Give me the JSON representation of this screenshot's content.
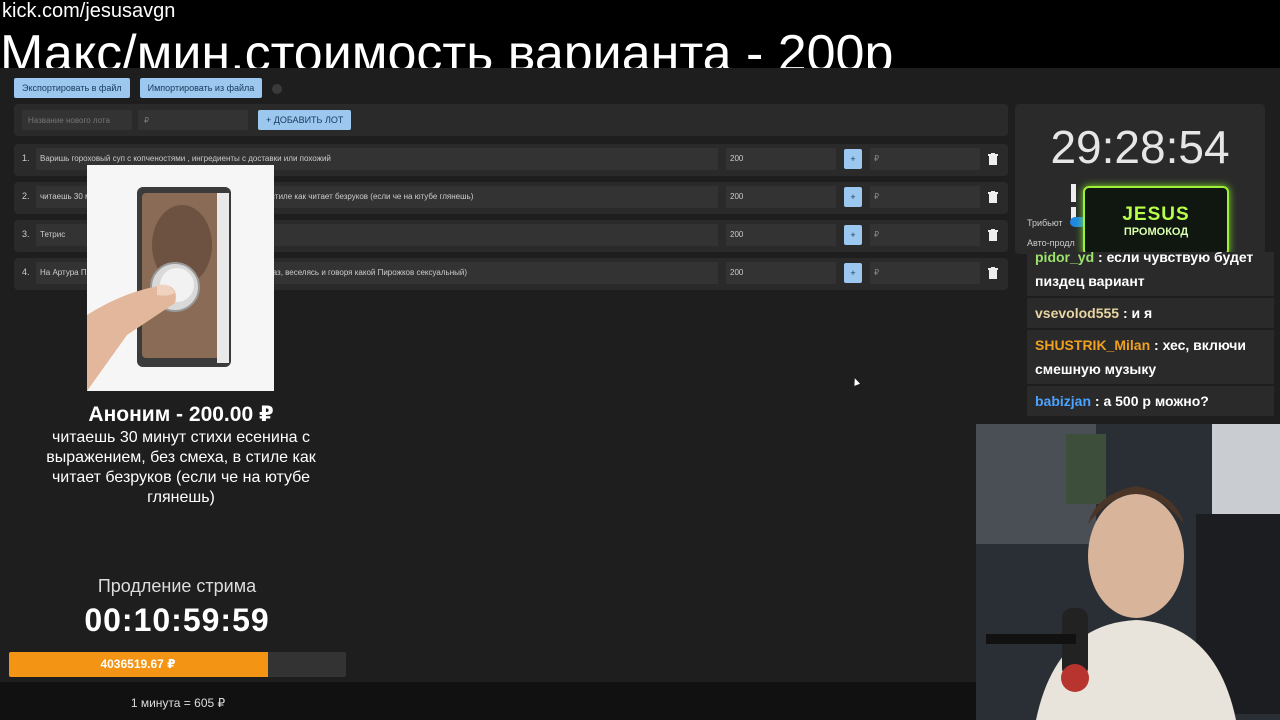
{
  "stream": {
    "url": "kick.com/jesusavgn",
    "headline": "Макс/мин.стоимость варианта - 200р"
  },
  "toolbar": {
    "export_label": "Экспортировать в файл",
    "import_label": "Импортировать из файла"
  },
  "new_lot": {
    "name_placeholder": "Название нового лота",
    "amount_placeholder": "₽",
    "add_label": "+ ДОБАВИТЬ ЛОТ"
  },
  "lots": [
    {
      "num": "1.",
      "name": "Варишь гороховый суп с копченостями , ингредиенты с доставки или похожий",
      "amount": "200",
      "plus": "+",
      "add_placeholder": "₽"
    },
    {
      "num": "2.",
      "name": "читаешь 30 минут стихи есенина с выражением, без смеха, в стиле как читает безруков (если че на ютубе глянешь)",
      "amount": "200",
      "plus": "+",
      "add_placeholder": "₽"
    },
    {
      "num": "3.",
      "name": "Тетрис",
      "amount": "200",
      "plus": "+",
      "add_placeholder": "₽"
    },
    {
      "num": "4.",
      "name": "На Артура Пирожкова, которого ты не посмотрел в прошлый раз, веселясь и говоря какой Пирожков сексуальный)",
      "amount": "200",
      "plus": "+",
      "add_placeholder": "₽"
    }
  ],
  "winner": {
    "title": "Аноним - 200.00 ₽",
    "text": "читаешь 30 минут стихи есенина с выражением, без смеха, в стиле как читает безруков (если че на ютубе глянешь)"
  },
  "extension": {
    "label": "Продление стрима",
    "timer": "00:10:59:59",
    "total": "4036519.67 ₽",
    "progress_fraction": 0.77,
    "rate": "1 минута = 605 ₽"
  },
  "auction": {
    "timer": "29:28:54",
    "tribute_label": "Трибьют",
    "auto_label": "Авто-продл"
  },
  "promo": {
    "title": "JESUS",
    "subtitle": "ПРОМОКОД"
  },
  "chat": [
    {
      "user": "pidor_yd",
      "text": " : если чувствую будет пиздец вариант",
      "color": "#9be36b"
    },
    {
      "user": "vsevolod555",
      "text": " : и я",
      "color": "#e8d5a2"
    },
    {
      "user": "SHUSTRIK_Milan",
      "text": " : хес, включи смешную музыку",
      "color": "#f0a020"
    },
    {
      "user": "babizjan",
      "text": " : а 500 р можно?",
      "color": "#4aa3ff"
    }
  ],
  "colors": {
    "accent": "#9cc7ef",
    "progress": "#f39414",
    "promo": "#9ef03a"
  }
}
